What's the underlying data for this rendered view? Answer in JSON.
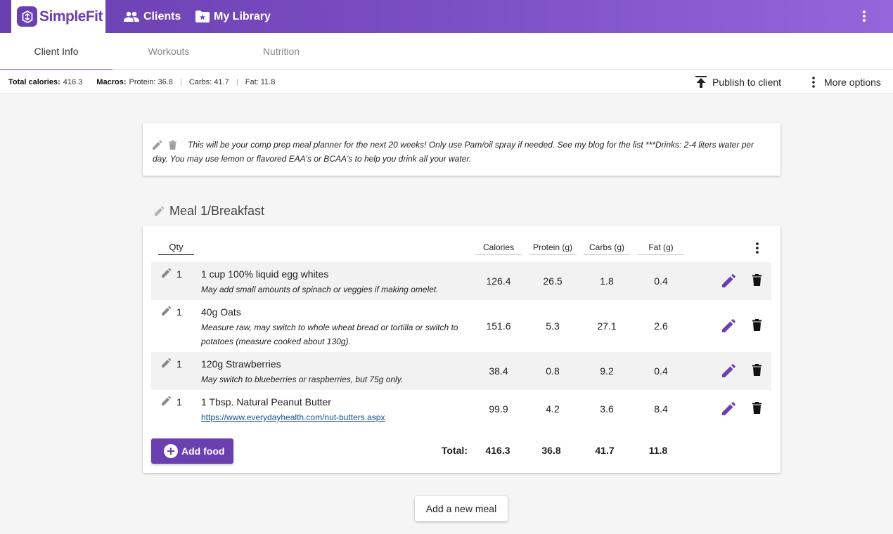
{
  "app": {
    "name": "SimpleFit",
    "brand_color": "#6a3fb0"
  },
  "nav": {
    "clients": "Clients",
    "library": "My Library"
  },
  "tabs": [
    "Client Info",
    "Workouts",
    "Nutrition"
  ],
  "summary": {
    "total_calories_label": "Total calories:",
    "total_calories": "416.3",
    "macros_label": "Macros:",
    "protein": "Protein: 36.8",
    "carbs": "Carbs: 41.7",
    "fat": "Fat: 11.8",
    "publish": "Publish to client",
    "more": "More options"
  },
  "note": "This will be your comp prep meal planner for the next 20 weeks! Only use Pam/oil spray if needed. See my blog for the list ***Drinks: 2-4 liters water per day. You may use lemon or flavored EAA's or BCAA's to help you drink all your water.",
  "meal": {
    "title": "Meal 1/Breakfast",
    "headers": {
      "qty": "Qty",
      "calories": "Calories",
      "protein": "Protein (g)",
      "carbs": "Carbs (g)",
      "fat": "Fat (g)"
    },
    "foods": [
      {
        "qty": "1",
        "name": "1 cup 100% liquid egg whites",
        "note": "May add small amounts of spinach or veggies if making omelet.",
        "calories": "126.4",
        "protein": "26.5",
        "carbs": "1.8",
        "fat": "0.4"
      },
      {
        "qty": "1",
        "name": "40g Oats",
        "note": "Measure raw, may switch to whole wheat bread or tortilla or switch to potatoes (measure cooked about 130g).",
        "calories": "151.6",
        "protein": "5.3",
        "carbs": "27.1",
        "fat": "2.6"
      },
      {
        "qty": "1",
        "name": "120g Strawberries",
        "note": "May switch to blueberries or raspberries, but 75g only.",
        "calories": "38.4",
        "protein": "0.8",
        "carbs": "9.2",
        "fat": "0.4"
      },
      {
        "qty": "1",
        "name": "1 Tbsp. Natural Peanut Butter",
        "link": "https://www.everydayhealth.com/nut-butters.aspx",
        "calories": "99.9",
        "protein": "4.2",
        "carbs": "3.6",
        "fat": "8.4"
      }
    ],
    "add_food": "Add food",
    "total_label": "Total:",
    "totals": {
      "calories": "416.3",
      "protein": "36.8",
      "carbs": "41.7",
      "fat": "11.8"
    }
  },
  "add_meal": "Add a new meal"
}
